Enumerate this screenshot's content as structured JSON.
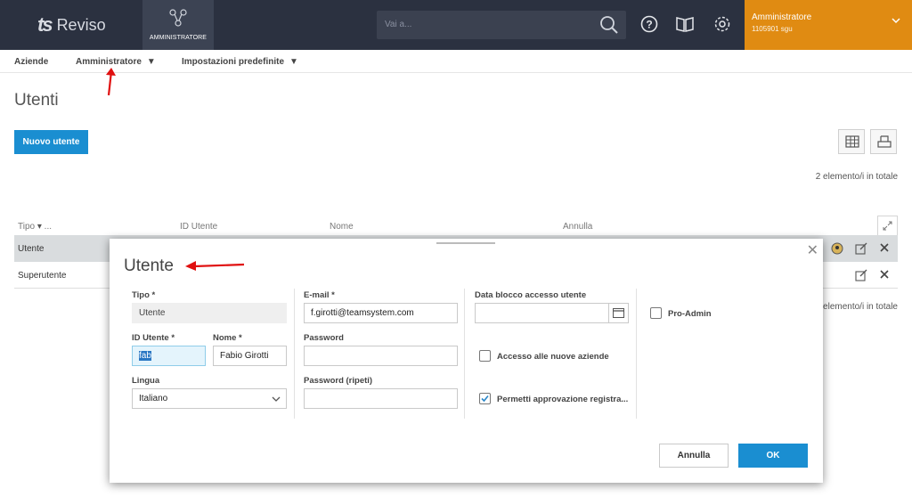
{
  "topbar": {
    "logo_text": "Reviso",
    "nav_label": "AMMINISTRATORE",
    "search_placeholder": "Vai a...",
    "user_name": "Amministratore",
    "user_sub": "1105901 sgu"
  },
  "subnav": {
    "items": [
      "Aziende",
      "Amministratore",
      "Impostazioni predefinite"
    ]
  },
  "page": {
    "title": "Utenti",
    "new_button": "Nuovo utente",
    "count": "2 elemento/i in totale",
    "count_bottom": "elemento/i in totale"
  },
  "table": {
    "columns": [
      "Tipo",
      "ID Utente",
      "Nome",
      "Annulla"
    ],
    "sort_indicator": "...",
    "rows": [
      "Utente",
      "Superutente"
    ]
  },
  "dialog": {
    "title": "Utente",
    "tipo_label": "Tipo *",
    "tipo_value": "Utente",
    "id_label": "ID Utente *",
    "id_value": "fab",
    "nome_label": "Nome *",
    "nome_value": "Fabio Girotti",
    "lingua_label": "Lingua",
    "lingua_value": "Italiano",
    "email_label": "E-mail *",
    "email_value": "f.girotti@teamsystem.com",
    "password_label": "Password",
    "password_repeat_label": "Password (ripeti)",
    "blocco_label": "Data blocco accesso utente",
    "accesso_label": "Accesso alle nuove aziende",
    "permetti_label": "Permetti approvazione registra...",
    "proadmin_label": "Pro-Admin",
    "cancel_button": "Annulla",
    "ok_button": "OK",
    "accesso_checked": false,
    "permetti_checked": true,
    "proadmin_checked": false
  },
  "colors": {
    "topbar": "#2b3140",
    "accent": "#1a8ed1",
    "user_box": "#e08b12",
    "annotation_arrow": "#e01010"
  }
}
